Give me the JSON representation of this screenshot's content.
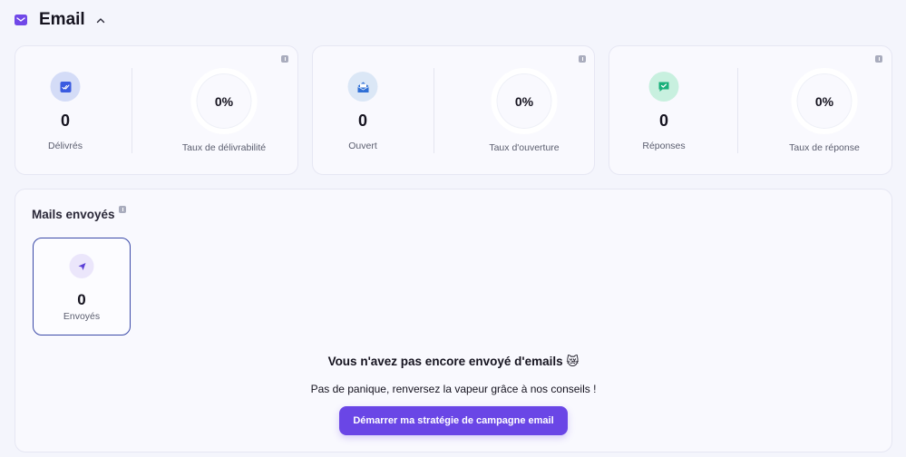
{
  "header": {
    "title": "Email",
    "icon": "mail-icon",
    "toggle_icon": "chevron-up-icon"
  },
  "stats_cards": [
    {
      "count": "0",
      "count_label": "Délivrés",
      "icon": "check-double-icon",
      "icon_color": "#3a5be0",
      "badge_color": "#d4dcf7",
      "rate": "0%",
      "rate_label": "Taux de délivrabilité"
    },
    {
      "count": "0",
      "count_label": "Ouvert",
      "icon": "open-envelope-icon",
      "icon_color": "#2f6fd6",
      "badge_color": "#dbe7f6",
      "rate": "0%",
      "rate_label": "Taux d'ouverture"
    },
    {
      "count": "0",
      "count_label": "Réponses",
      "icon": "reply-chat-icon",
      "icon_color": "#18b07a",
      "badge_color": "#c8f0df",
      "rate": "0%",
      "rate_label": "Taux de réponse"
    }
  ],
  "sent_panel": {
    "title": "Mails envoyés",
    "tile": {
      "count": "0",
      "label": "Envoyés",
      "icon": "paper-plane-icon"
    },
    "empty_title": "Vous n'avez pas encore envoyé d'emails 😿",
    "empty_subtitle": "Pas de panique, renversez la vapeur grâce à nos conseils !",
    "cta_label": "Démarrer ma stratégie de campagne email"
  },
  "colors": {
    "accent": "#6a46e6",
    "background": "#f4f5fc",
    "card": "#f9f9fe",
    "tile_border": "#3b4aa8"
  }
}
